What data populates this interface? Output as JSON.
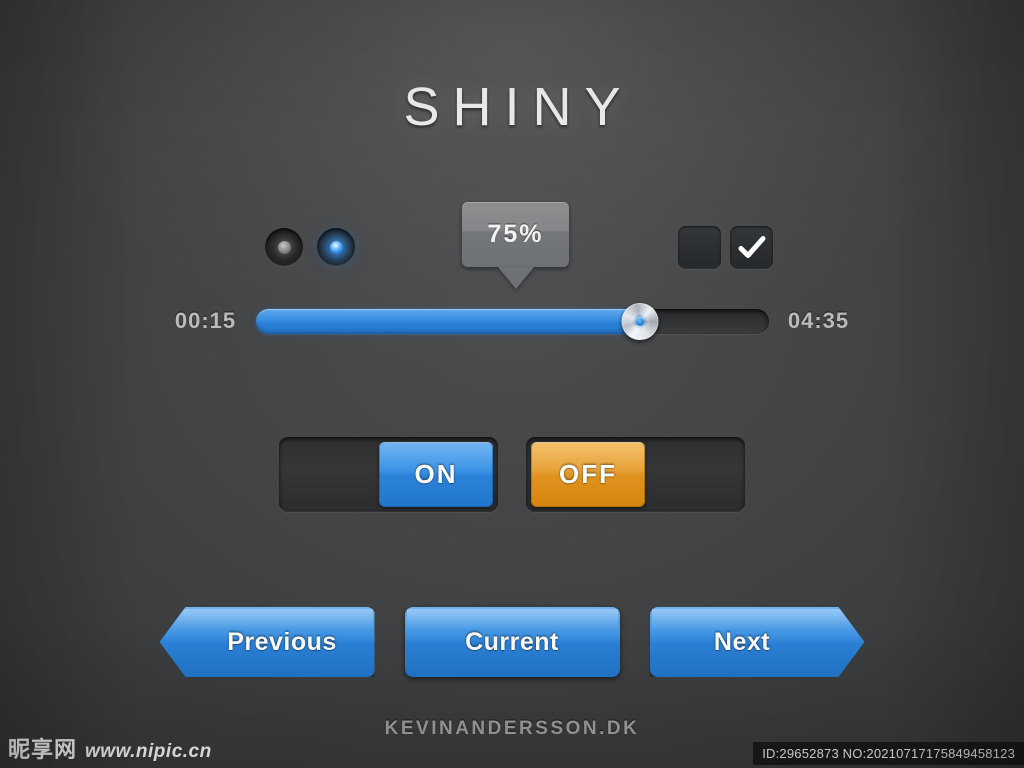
{
  "title": "SHINY",
  "radios": [
    {
      "name": "radio-option-1",
      "state": "off"
    },
    {
      "name": "radio-option-2",
      "state": "on"
    }
  ],
  "tooltip": {
    "value": "75%"
  },
  "checkboxes": [
    {
      "name": "checkbox-option-1",
      "checked": false
    },
    {
      "name": "checkbox-option-2",
      "checked": true
    }
  ],
  "slider": {
    "start_time": "00:15",
    "end_time": "04:35",
    "percent": 75,
    "fill_color": "#2d85dd",
    "track_color": "#2f3132",
    "handle_icon": "slider-knob-icon"
  },
  "toggles": [
    {
      "label": "ON",
      "state": "on",
      "knob_color": "#2f8ae0"
    },
    {
      "label": "OFF",
      "state": "off",
      "knob_color": "#e0931f"
    }
  ],
  "nav_buttons": [
    {
      "label": "Previous",
      "shape": "left-arrow"
    },
    {
      "label": "Current",
      "shape": "rectangle"
    },
    {
      "label": "Next",
      "shape": "right-arrow"
    }
  ],
  "footer": "KEVINANDERSSON.DK",
  "watermark": {
    "logo_text": "昵享网",
    "url": "www.nipic.cn",
    "id_text": "ID:29652873 NO:20210717175849458123"
  },
  "colors": {
    "background": "#414345",
    "accent_blue": "#2d85dd",
    "accent_orange": "#e0931f",
    "text_light": "#e9eaeb"
  }
}
